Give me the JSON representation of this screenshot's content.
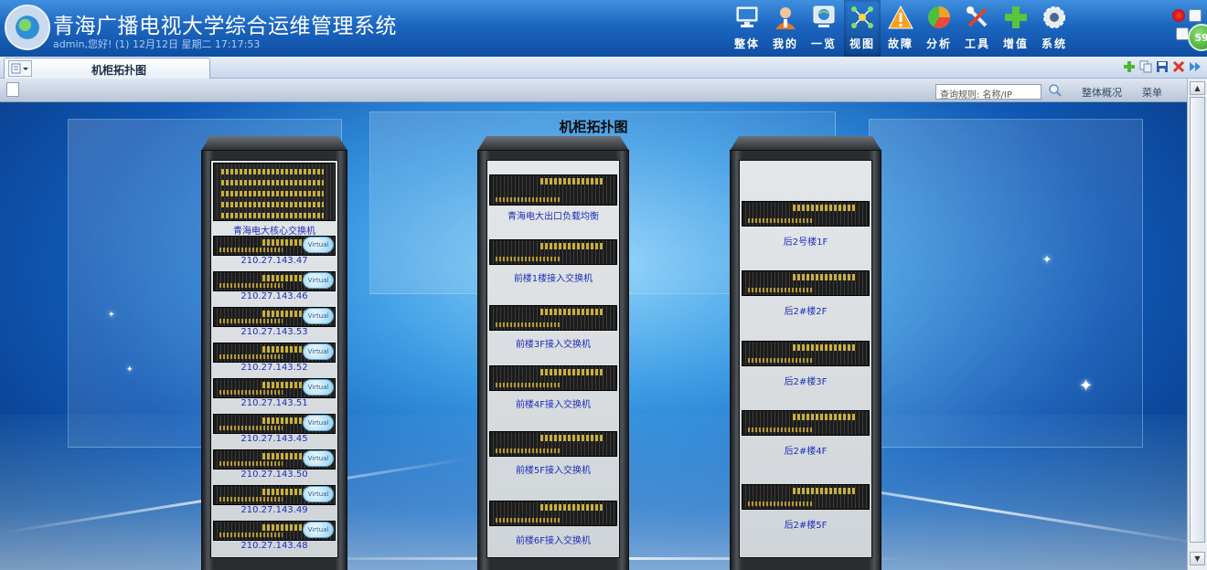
{
  "header": {
    "title": "青海广播电视大学综合运维管理系统",
    "user_info": "admin,您好! (1) 12月12日 星期二 17:17:53",
    "alarm_count": "59",
    "nav": [
      {
        "label": "整体",
        "icon": "monitor-icon",
        "active": false
      },
      {
        "label": "我的",
        "icon": "user-icon",
        "active": false
      },
      {
        "label": "一览",
        "icon": "globe-screen-icon",
        "active": false
      },
      {
        "label": "视图",
        "icon": "topology-icon",
        "active": true
      },
      {
        "label": "故障",
        "icon": "warning-icon",
        "active": false
      },
      {
        "label": "分析",
        "icon": "pie-chart-icon",
        "active": false
      },
      {
        "label": "工具",
        "icon": "tools-icon",
        "active": false
      },
      {
        "label": "增值",
        "icon": "plus-icon",
        "active": false
      },
      {
        "label": "系统",
        "icon": "gear-icon",
        "active": false
      }
    ]
  },
  "tabs": {
    "active_label": "机柜拓扑图"
  },
  "toolbar": {
    "search_placeholder": "查询规则: 名称/IP",
    "overview_label": "整体概况",
    "menu_label": "菜单"
  },
  "stage": {
    "title": "机柜拓扑图"
  },
  "racks": [
    {
      "name": "rack-1",
      "core_label": "青海电大核心交换机",
      "servers": [
        "210.27.143.47",
        "210.27.143.46",
        "210.27.143.53",
        "210.27.143.52",
        "210.27.143.51",
        "210.27.143.45",
        "210.27.143.50",
        "210.27.143.49",
        "210.27.143.48"
      ],
      "server_badge": "Virtual"
    },
    {
      "name": "rack-2",
      "devices": [
        "青海电大出口负载均衡",
        "前楼1楼接入交换机",
        "前楼3F接入交换机",
        "前楼4F接入交换机",
        "前楼5F接入交换机",
        "前楼6F接入交换机"
      ]
    },
    {
      "name": "rack-3",
      "devices": [
        "后2号楼1F",
        "后2#楼2F",
        "后2#楼3F",
        "后2#楼4F",
        "后2#楼5F"
      ]
    }
  ],
  "colors": {
    "header_top": "#3f8fde",
    "header_bottom": "#0f4ea3",
    "device_label": "#1d2db8",
    "stage_center": "#8ed3fb"
  }
}
